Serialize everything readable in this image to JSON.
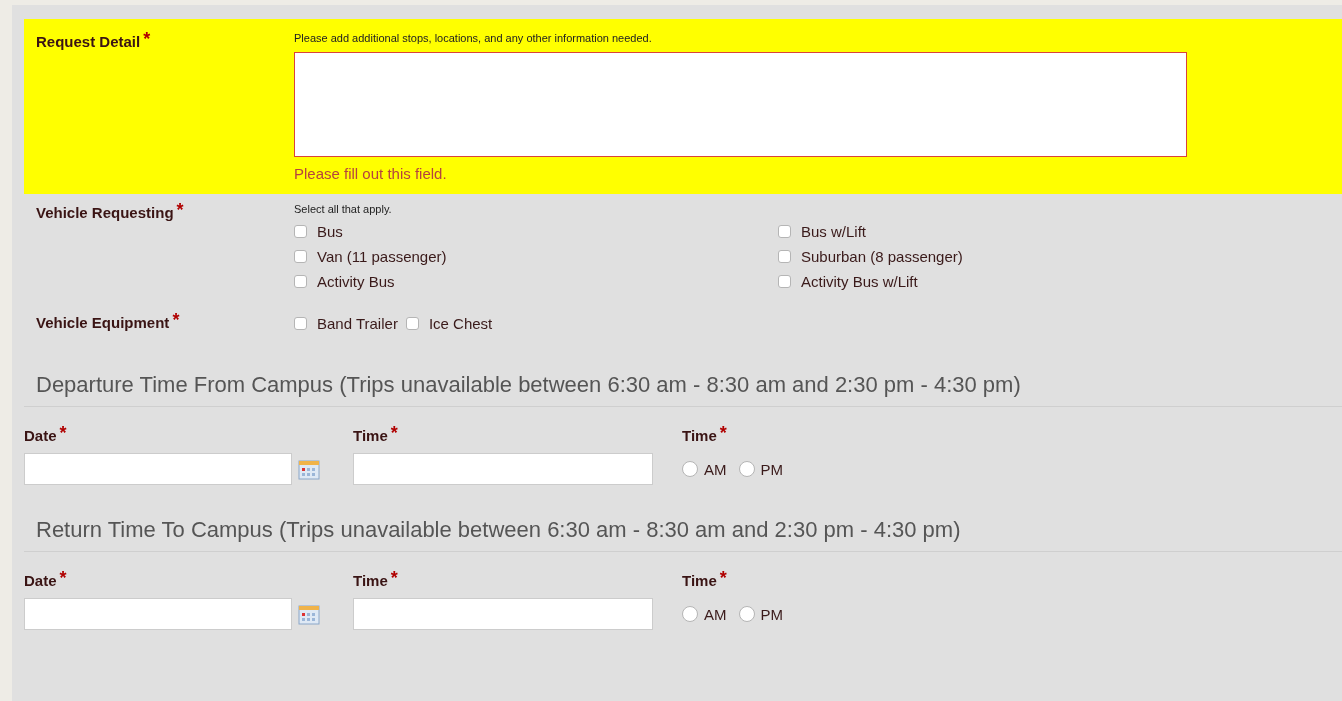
{
  "request_detail": {
    "label": "Request Detail",
    "mark": "*",
    "hint": "Please add additional stops, locations, and any other information needed.",
    "error": "Please fill out this field.",
    "invalid": true
  },
  "vehicle_requesting": {
    "label": "Vehicle Requesting",
    "mark": "*",
    "hint": "Select all that apply.",
    "options": [
      {
        "label": "Bus",
        "checked": false
      },
      {
        "label": "Bus w/Lift",
        "checked": false
      },
      {
        "label": "Van (11 passenger)",
        "checked": false
      },
      {
        "label": "Suburban (8 passenger)",
        "checked": false
      },
      {
        "label": "Activity Bus",
        "checked": false
      },
      {
        "label": "Activity Bus w/Lift",
        "checked": false
      }
    ]
  },
  "vehicle_equipment": {
    "label": "Vehicle Equipment",
    "mark": "*",
    "options": [
      {
        "label": "Band Trailer",
        "checked": false
      },
      {
        "label": "Ice Chest",
        "checked": false
      }
    ]
  },
  "sections": [
    {
      "title": "Departure Time From Campus (Trips unavailable between 6:30 am - 8:30 am and 2:30 pm - 4:30 pm)",
      "date_label": "Date",
      "date_mark": "*",
      "time_label": "Time",
      "time_mark": "*",
      "period_label": "Time",
      "period_mark": "*",
      "periods": [
        {
          "label": "AM",
          "selected": false
        },
        {
          "label": "PM",
          "selected": false
        }
      ]
    },
    {
      "title": "Return Time To Campus (Trips unavailable between 6:30 am - 8:30 am and 2:30 pm - 4:30 pm)",
      "date_label": "Date",
      "date_mark": "*",
      "time_label": "Time",
      "time_mark": "*",
      "period_label": "Time",
      "period_mark": "*",
      "periods": [
        {
          "label": "AM",
          "selected": false
        },
        {
          "label": "PM",
          "selected": false
        }
      ]
    }
  ]
}
